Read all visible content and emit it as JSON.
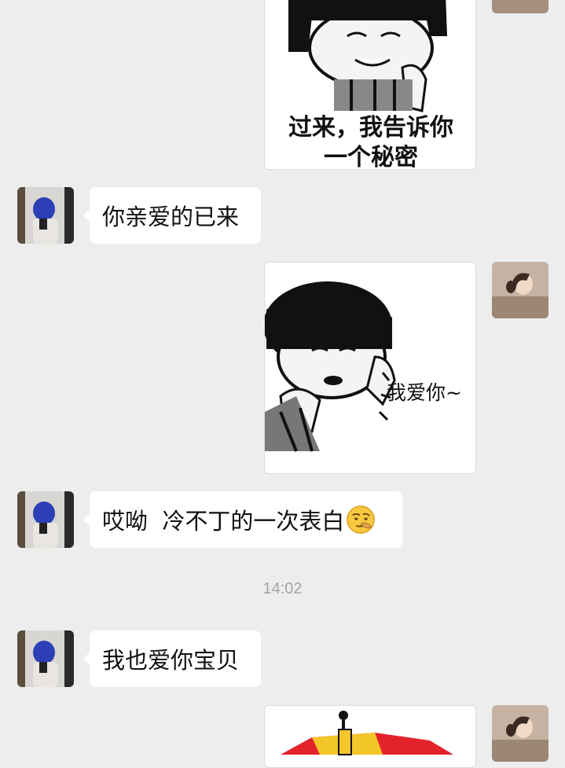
{
  "messages": {
    "m1_sticker_caption_line1": "过来，我告诉你",
    "m1_sticker_caption_line2": "一个秘密",
    "m2_text": "你亲爱的已来",
    "m3_sticker_caption": "我爱你~",
    "m4_text": "哎呦  冷不丁的一次表白",
    "m4_emoji": "smirking-face-emoji",
    "timestamp": "14:02",
    "m5_text": "我也爱你宝贝"
  },
  "colors": {
    "background": "#ededed",
    "bubble": "#ffffff",
    "timestamp": "#a3a3a3"
  }
}
